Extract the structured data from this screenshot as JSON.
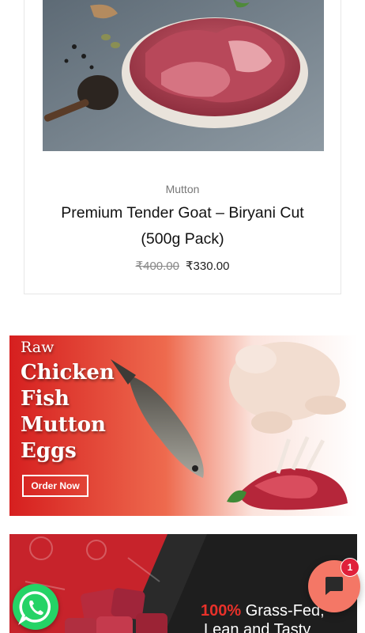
{
  "product": {
    "category": "Mutton",
    "title_line1": "Premium Tender Goat – Biryani Cut",
    "title_line2": "(500g Pack)",
    "old_price": "₹400.00",
    "new_price": "₹330.00"
  },
  "banner_raw": {
    "line_raw": "Raw",
    "line_chicken": "Chicken",
    "line_fish": "Fish",
    "line_mutton": "Mutton",
    "line_eggs": "Eggs",
    "order_button": "Order Now"
  },
  "banner_grass": {
    "highlight": "100%",
    "line1_rest": " Grass-Fed,",
    "line2": "Lean and Tasty"
  },
  "chat": {
    "badge_count": "1"
  },
  "colors": {
    "banner_red": "#e8312a",
    "whatsapp_green": "#25d366",
    "chat_coral": "#f47766",
    "badge_red": "#e0203a"
  },
  "icons": [
    "whatsapp-icon",
    "chat-bubble-icon"
  ]
}
